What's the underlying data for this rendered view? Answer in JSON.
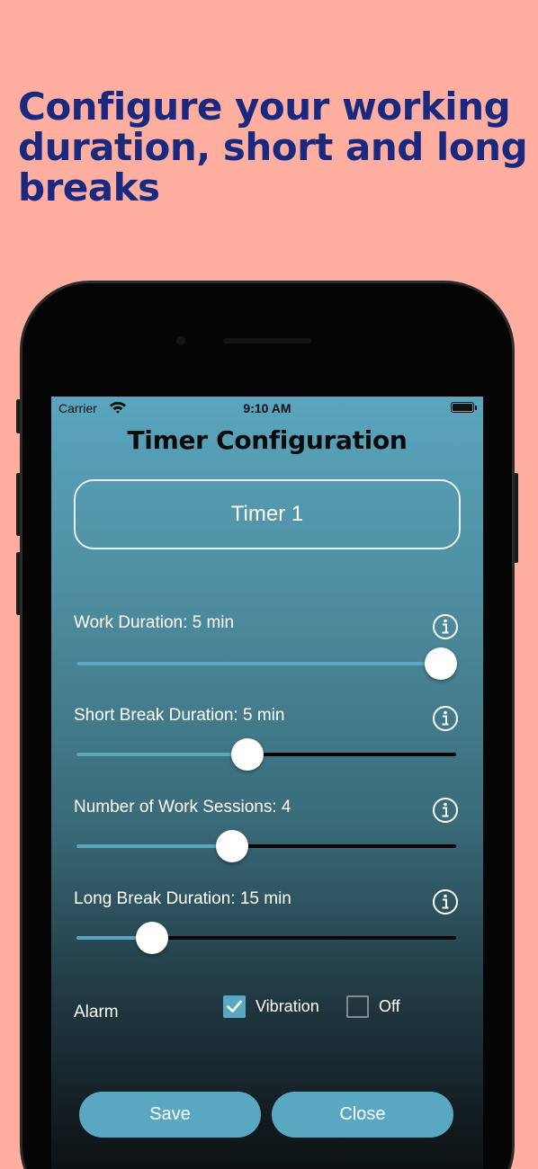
{
  "headline": "Configure your working duration, short and long breaks",
  "status_bar": {
    "carrier": "Carrier",
    "time": "9:10 AM"
  },
  "screen_title": "Timer Configuration",
  "timer_name": "Timer 1",
  "settings": [
    {
      "label": "Work Duration: 5 min",
      "level": 0.96
    },
    {
      "label": "Short Break Duration: 5 min",
      "level": 0.45
    },
    {
      "label": "Number of Work Sessions: 4",
      "level": 0.41
    },
    {
      "label": "Long Break Duration: 15 min",
      "level": 0.2
    }
  ],
  "alarm": {
    "label": "Alarm",
    "options": [
      {
        "label": "Vibration",
        "checked": true
      },
      {
        "label": "Off",
        "checked": false
      }
    ]
  },
  "buttons": {
    "save": "Save",
    "close": "Close"
  },
  "colors": {
    "background": "#ffaea0",
    "headline": "#19297f",
    "accent": "#5aa7c1",
    "track": "#060606"
  }
}
